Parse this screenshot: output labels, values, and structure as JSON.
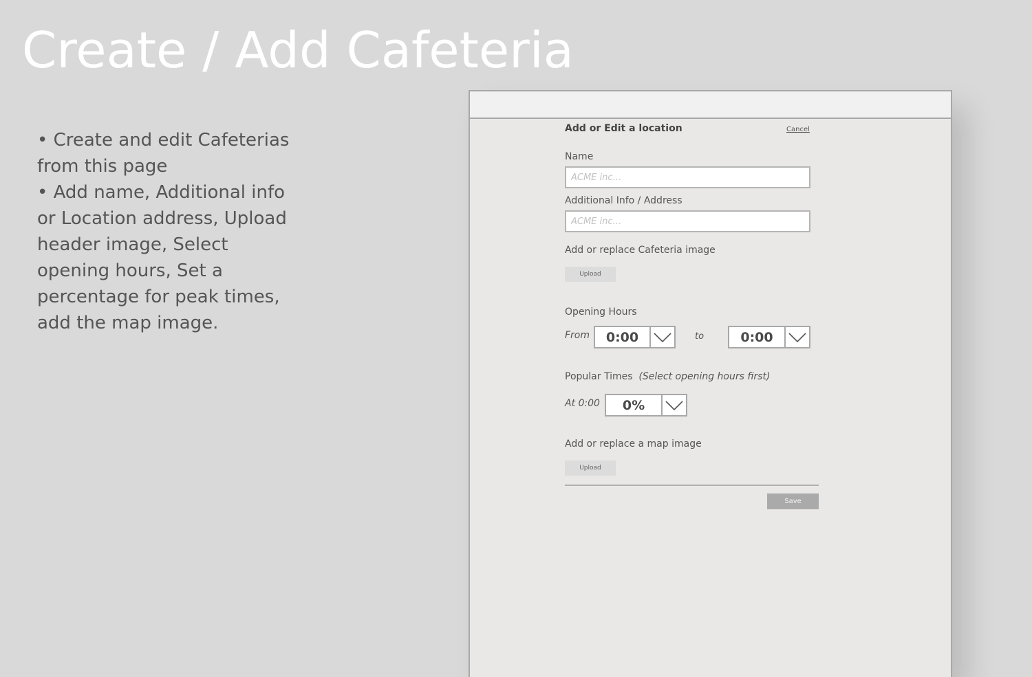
{
  "page": {
    "title": "Create / Add Cafeteria"
  },
  "description": {
    "bullets": [
      "• Create and edit Cafeterias from this page",
      "• Add name, Additional info or Location address, Upload header image, Select opening hours, Set a percentage for peak times, add the map image."
    ]
  },
  "form": {
    "title": "Add or Edit a location",
    "cancel_label": "Cancel",
    "name": {
      "label": "Name",
      "placeholder": "ACME inc…",
      "value": ""
    },
    "additional_info": {
      "label": "Additional Info / Address",
      "placeholder": "ACME inc…",
      "value": ""
    },
    "cafeteria_image": {
      "label": "Add or replace Cafeteria image",
      "upload_label": "Upload"
    },
    "opening_hours": {
      "label": "Opening Hours",
      "from_label": "From",
      "from_value": "0:00",
      "to_label": "to",
      "to_value": "0:00"
    },
    "popular_times": {
      "label": "Popular Times",
      "hint": "(Select opening hours first)",
      "at_label": "At 0:00",
      "value": "0%"
    },
    "map_image": {
      "label": "Add or replace a map image",
      "upload_label": "Upload"
    },
    "save_label": "Save"
  },
  "icons": {
    "dropdown": "chevron-down-icon"
  }
}
